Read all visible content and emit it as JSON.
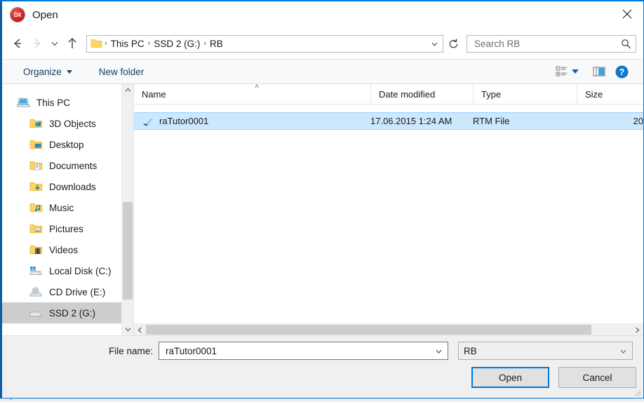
{
  "window": {
    "title": "Open",
    "app_icon": "dx-app-icon",
    "icon_label": "DX",
    "close_label": "Close"
  },
  "nav": {
    "back": "Back",
    "forward": "Forward",
    "recent": "Recent locations",
    "up": "Up",
    "refresh": "Refresh",
    "breadcrumbs": [
      {
        "label": "This PC"
      },
      {
        "label": "SSD 2 (G:)"
      },
      {
        "label": "RB"
      }
    ],
    "separator": "›",
    "dropdown": "Previous locations"
  },
  "search": {
    "placeholder": "Search RB",
    "value": ""
  },
  "commandbar": {
    "organize_label": "Organize",
    "new_folder_label": "New folder",
    "view_label": "Change your view",
    "preview_label": "Show the preview pane",
    "help_label": "Help",
    "help_glyph": "?"
  },
  "sidebar": {
    "items": [
      {
        "label": "This PC",
        "icon": "this-pc-icon",
        "indent": false,
        "selected": false
      },
      {
        "label": "3D Objects",
        "icon": "folder-3d-objects-icon",
        "indent": true,
        "selected": false
      },
      {
        "label": "Desktop",
        "icon": "folder-desktop-icon",
        "indent": true,
        "selected": false
      },
      {
        "label": "Documents",
        "icon": "folder-documents-icon",
        "indent": true,
        "selected": false
      },
      {
        "label": "Downloads",
        "icon": "folder-downloads-icon",
        "indent": true,
        "selected": false
      },
      {
        "label": "Music",
        "icon": "folder-music-icon",
        "indent": true,
        "selected": false
      },
      {
        "label": "Pictures",
        "icon": "folder-pictures-icon",
        "indent": true,
        "selected": false
      },
      {
        "label": "Videos",
        "icon": "folder-videos-icon",
        "indent": true,
        "selected": false
      },
      {
        "label": "Local Disk (C:)",
        "icon": "local-disk-icon",
        "indent": true,
        "selected": false
      },
      {
        "label": "CD Drive (E:)",
        "icon": "cd-drive-icon",
        "indent": true,
        "selected": false
      },
      {
        "label": "SSD 2 (G:)",
        "icon": "hard-drive-icon",
        "indent": true,
        "selected": true
      }
    ]
  },
  "filelist": {
    "columns": [
      {
        "key": "name",
        "label": "Name",
        "sorted": true,
        "sort_glyph": "˄"
      },
      {
        "key": "date",
        "label": "Date modified",
        "sorted": false
      },
      {
        "key": "type",
        "label": "Type",
        "sorted": false
      },
      {
        "key": "size",
        "label": "Size",
        "sorted": false
      }
    ],
    "rows": [
      {
        "name": "raTutor0001",
        "date": "17.06.2015 1:24 AM",
        "type": "RTM File",
        "size": "20",
        "icon": "rtm-file-icon",
        "selected": true
      }
    ]
  },
  "footer": {
    "filename_label": "File name:",
    "filename_value": "raTutor0001",
    "filename_placeholder": "",
    "filter_value": "RB",
    "open_label": "Open",
    "cancel_label": "Cancel"
  },
  "background": {
    "bleed_text": "byJIXKUBICUDJCUD"
  },
  "colors": {
    "accent": "#0078d7",
    "selection": "#cce8ff",
    "sidebar_selection": "#cdcdcd",
    "command_text": "#1c3e66",
    "chrome": "#f0f0f0"
  }
}
